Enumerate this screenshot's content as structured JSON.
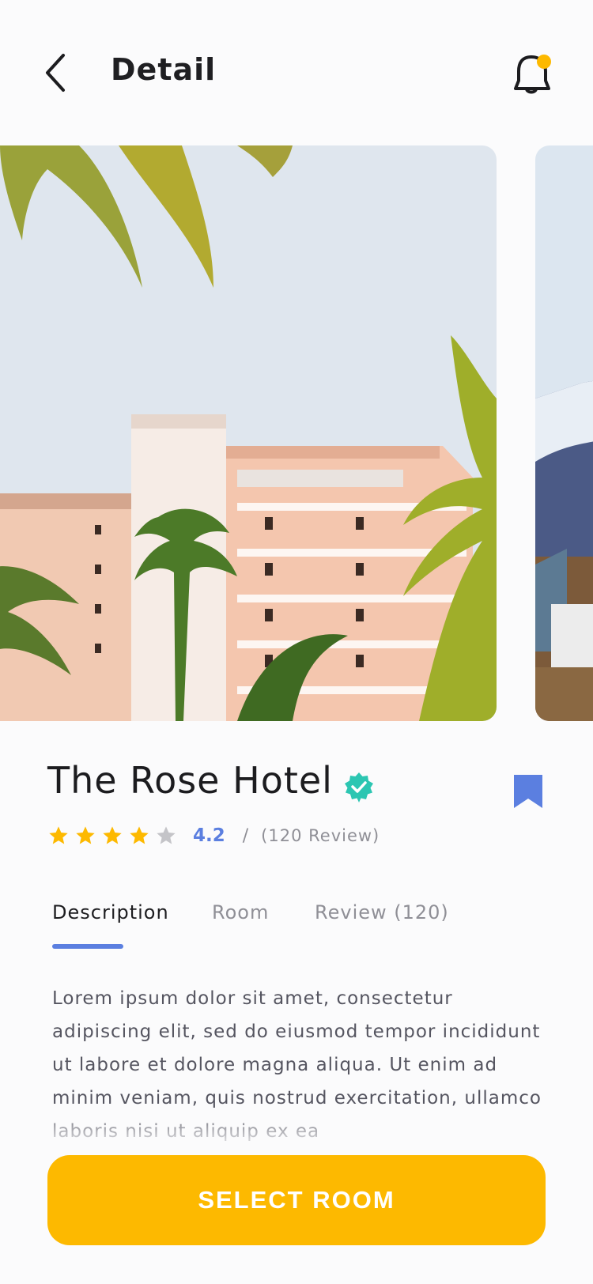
{
  "header": {
    "title": "Detail"
  },
  "hotel": {
    "name": "The Rose Hotel",
    "rating_value": "4.2",
    "rating_separator": "/",
    "review_count": "(120 Review)",
    "stars": [
      {
        "icon": "star-icon",
        "state": "filled"
      },
      {
        "icon": "star-icon",
        "state": "filled"
      },
      {
        "icon": "star-icon",
        "state": "filled"
      },
      {
        "icon": "star-icon",
        "state": "filled"
      },
      {
        "icon": "star-icon",
        "state": "empty"
      }
    ]
  },
  "tabs": [
    {
      "label": "Description",
      "active": true
    },
    {
      "label": "Room",
      "active": false
    },
    {
      "label": "Review (120)",
      "active": false
    }
  ],
  "description": "Lorem ipsum dolor sit amet, consectetur adipiscing elit, sed do eiusmod tempor incididunt ut labore et dolore magna aliqua. Ut enim ad minim veniam, quis nostrud exercitation, ullamco laboris nisi ut aliquip ex ea",
  "cta": {
    "label": "SELECT ROOM"
  },
  "colors": {
    "accent_blue": "#5b7fe0",
    "cta_yellow": "#fdb900",
    "star_yellow": "#fdb900",
    "verified_green": "#2cc6b2",
    "notification_dot": "#fdb900"
  },
  "icons": {
    "back": "chevron-left-icon",
    "notification": "bell-icon",
    "verified": "verified-badge-icon",
    "bookmark": "bookmark-icon"
  }
}
